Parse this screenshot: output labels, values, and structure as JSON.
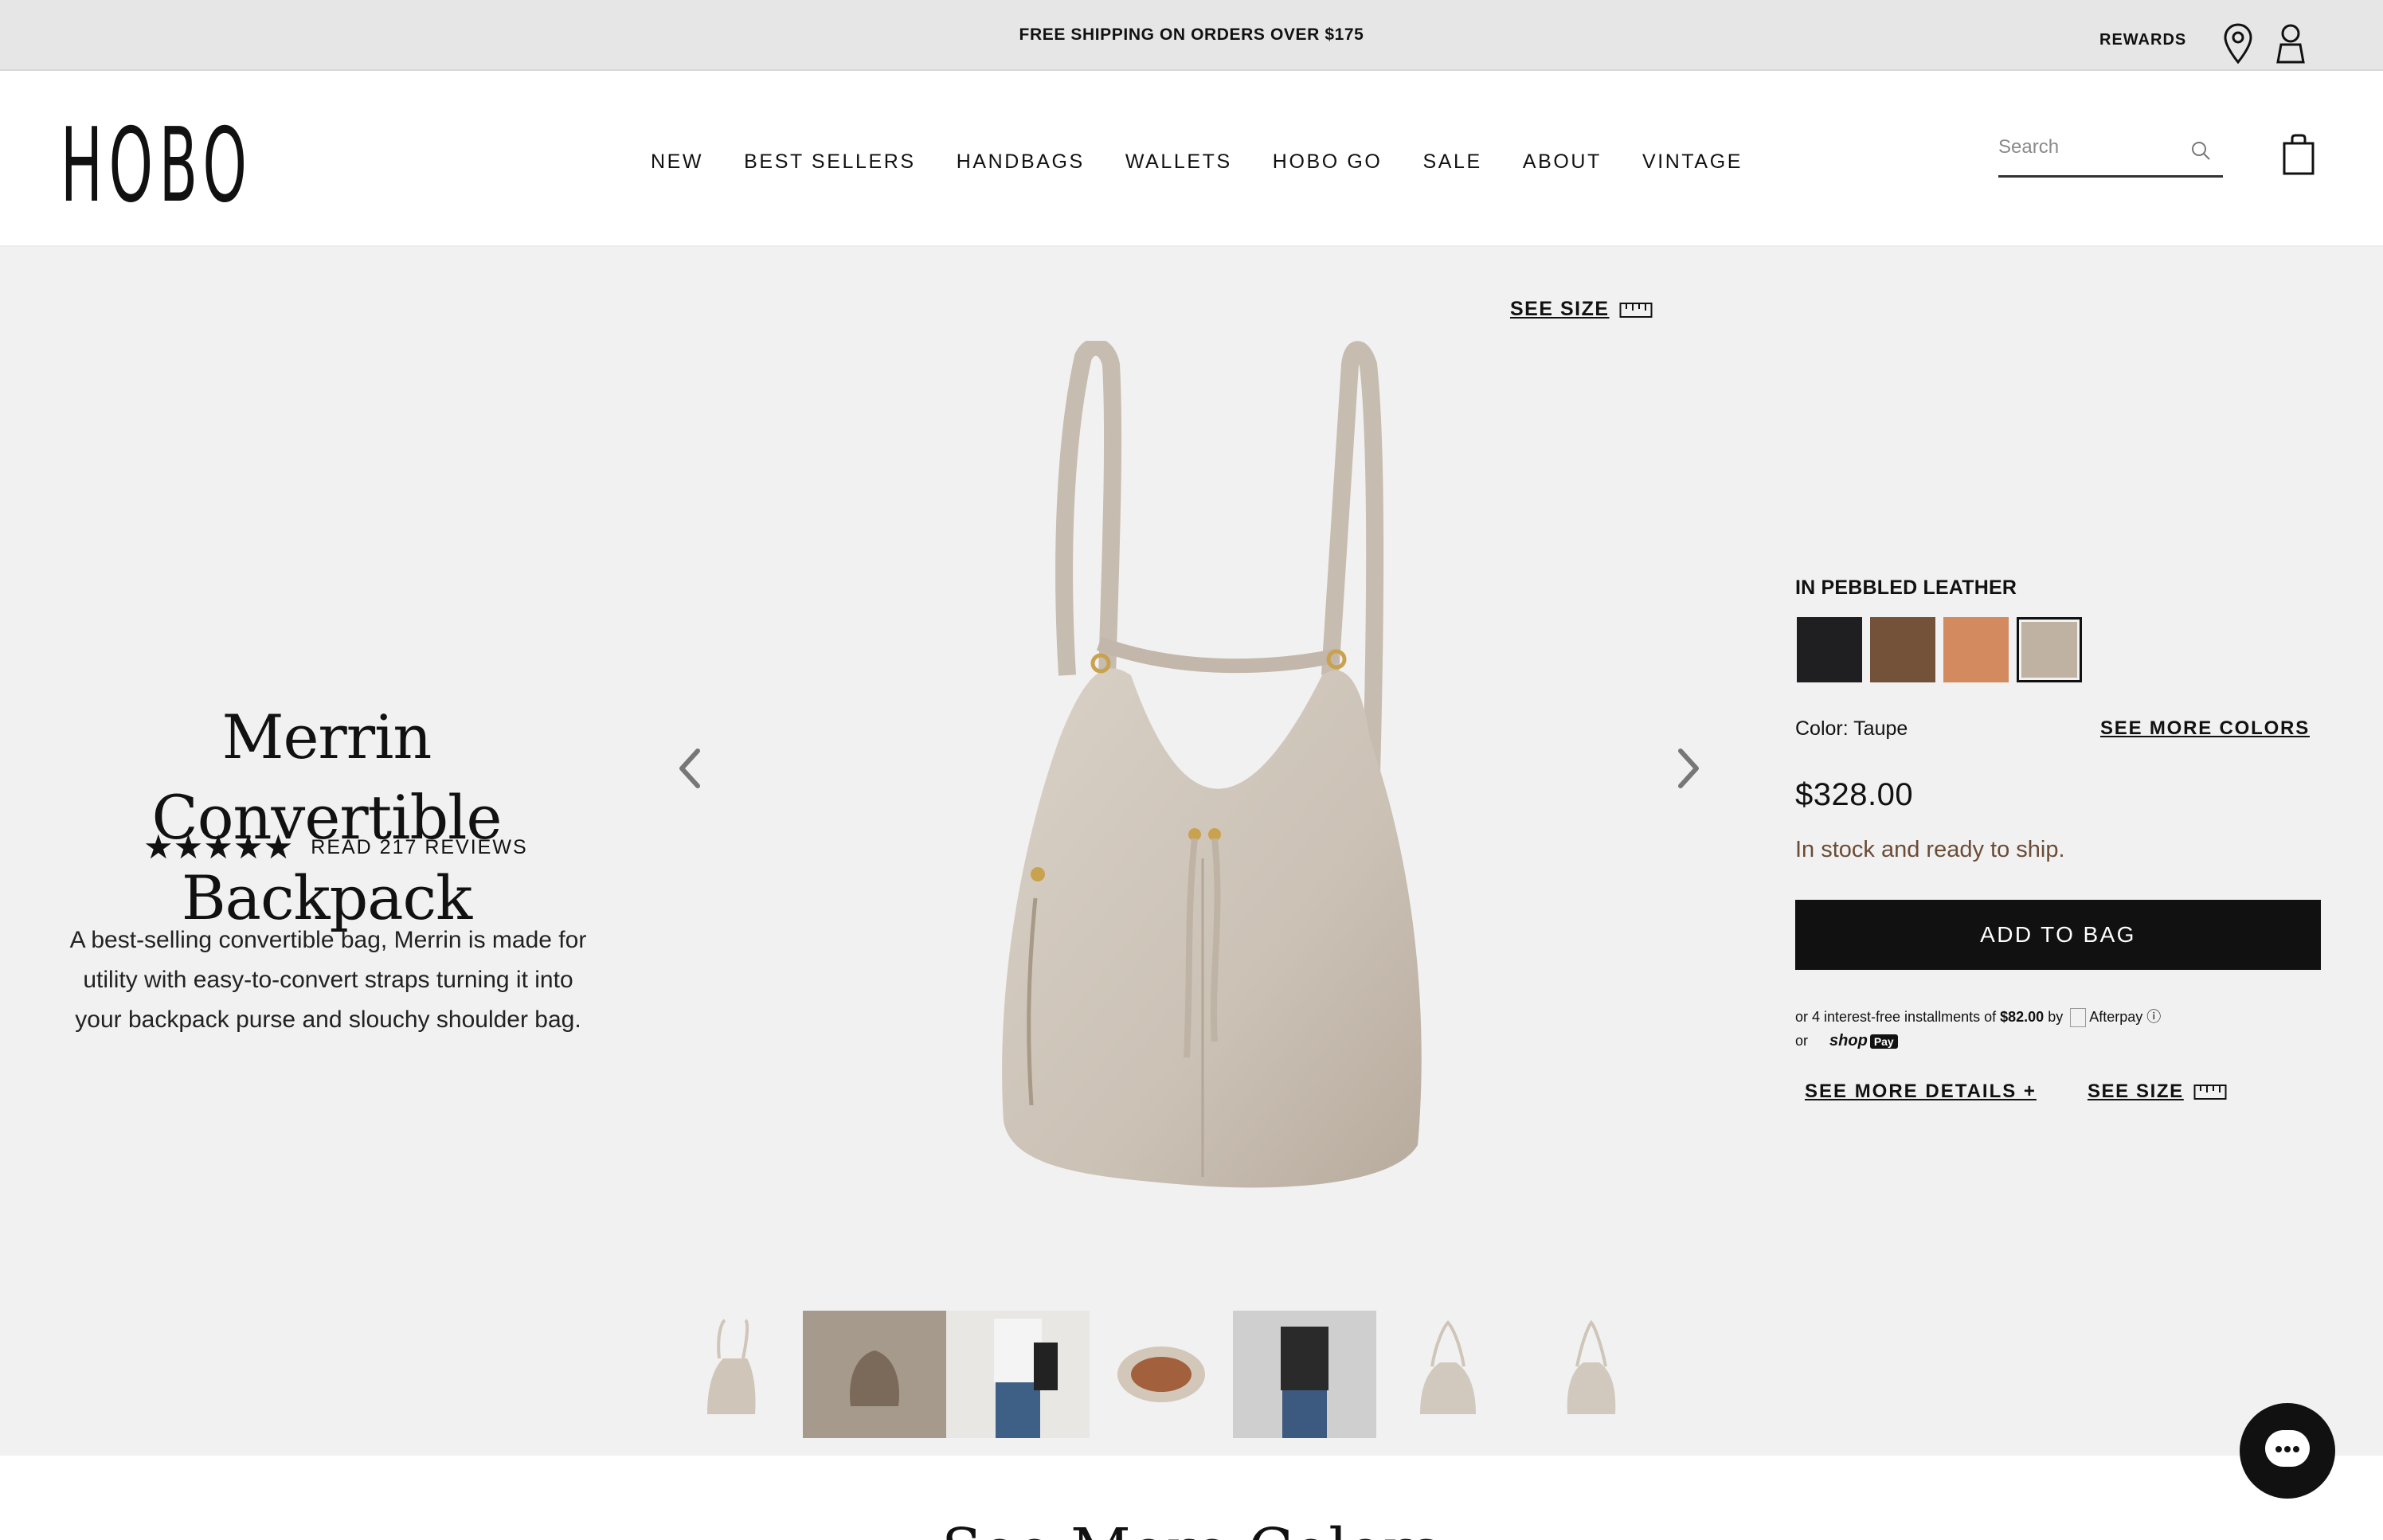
{
  "topbar": {
    "promo": "FREE SHIPPING ON ORDERS OVER $175",
    "rewards": "REWARDS",
    "icons": [
      "location-pin-icon",
      "account-icon"
    ]
  },
  "header": {
    "logo": "HOBO",
    "nav": [
      "NEW",
      "BEST SELLERS",
      "HANDBAGS",
      "WALLETS",
      "HOBO GO",
      "SALE",
      "ABOUT",
      "VINTAGE"
    ],
    "search_placeholder": "Search",
    "icons": [
      "search-icon",
      "shopping-bag-icon"
    ]
  },
  "product": {
    "title_line1": "Merrin Convertible",
    "title_line2": "Backpack",
    "stars": "★★★★★",
    "rating_value": 5,
    "reviews_link": "READ 217 REVIEWS",
    "description": "A best-selling convertible bag, Merrin is made for utility with easy-to-convert straps turning it into your backpack purse and slouchy shoulder bag.",
    "see_size": "SEE SIZE"
  },
  "gallery": {
    "thumbnails": [
      {
        "name": "front view"
      },
      {
        "name": "lifestyle grey"
      },
      {
        "name": "model shoulder"
      },
      {
        "name": "interior"
      },
      {
        "name": "model backpack"
      },
      {
        "name": "front open"
      },
      {
        "name": "side view"
      }
    ]
  },
  "buy_box": {
    "material_label": "IN PEBBLED LEATHER",
    "swatches": [
      {
        "name": "Black",
        "color": "#1f1f22"
      },
      {
        "name": "Brown",
        "color": "#74523a"
      },
      {
        "name": "Tan",
        "color": "#d38a5f"
      },
      {
        "name": "Taupe",
        "color": "#bfb2a3",
        "selected": true
      }
    ],
    "color_label": "Color: Taupe",
    "see_more_colors": "SEE MORE COLORS",
    "price": "$328.00",
    "stock": "In stock and ready to ship.",
    "add_to_bag": "ADD TO BAG",
    "installments_prefix": "or 4 interest-free installments of",
    "installment_amount": "$82.00",
    "installments_by": "by",
    "afterpay_alt": "Afterpay",
    "info_glyph": "ⓘ",
    "or_label": "or",
    "shoppay_label": "shop",
    "shoppay_badge": "Pay",
    "see_more_details": "SEE MORE DETAILS +",
    "see_size": "SEE SIZE"
  },
  "below": {
    "heading": "See More Colors"
  }
}
